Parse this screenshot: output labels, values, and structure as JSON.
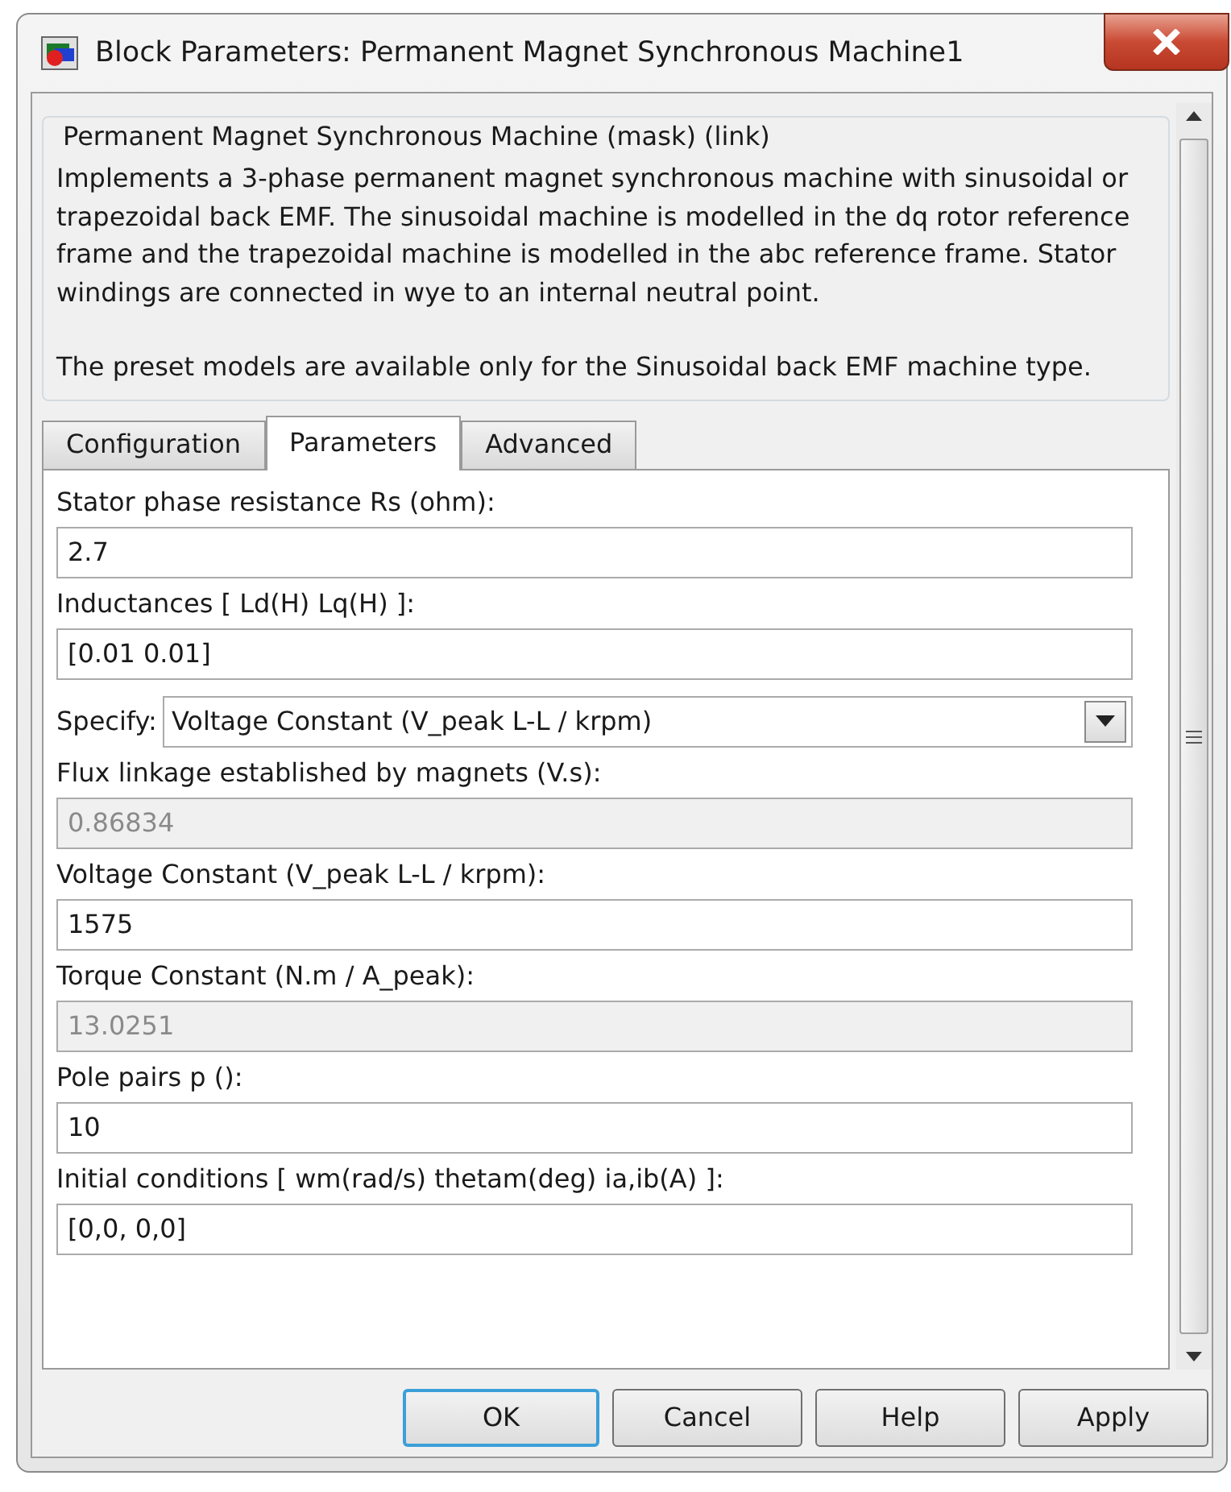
{
  "window": {
    "title": "Block Parameters: Permanent Magnet Synchronous Machine1"
  },
  "description": {
    "legend": "Permanent Magnet Synchronous Machine (mask) (link)",
    "paragraphs": [
      "Implements a 3-phase permanent magnet synchronous machine with sinusoidal or trapezoidal back EMF. The sinusoidal machine is modelled in the dq rotor reference frame and the trapezoidal machine is modelled in the abc reference frame. Stator windings are connected in wye to an internal neutral point.",
      "The preset models are available only for the Sinusoidal back EMF machine type."
    ]
  },
  "tabs": [
    {
      "label": "Configuration",
      "selected": false
    },
    {
      "label": "Parameters",
      "selected": true
    },
    {
      "label": "Advanced",
      "selected": false
    }
  ],
  "parameters": [
    {
      "kind": "text",
      "label": "Stator phase resistance Rs (ohm):",
      "value": "2.7",
      "disabled": false
    },
    {
      "kind": "text",
      "label": "Inductances [ Ld(H) Lq(H) ]:",
      "value": "[0.01 0.01]",
      "disabled": false
    },
    {
      "kind": "select",
      "label": "Specify:",
      "value": "Voltage Constant (V_peak L-L / krpm)",
      "disabled": false
    },
    {
      "kind": "text",
      "label": "Flux linkage established by magnets (V.s):",
      "value": "0.86834",
      "disabled": true
    },
    {
      "kind": "text",
      "label": "Voltage Constant (V_peak L-L / krpm):",
      "value": "1575",
      "disabled": false
    },
    {
      "kind": "text",
      "label": "Torque Constant (N.m / A_peak):",
      "value": "13.0251",
      "disabled": true
    },
    {
      "kind": "text",
      "label": "Pole pairs p ():",
      "value": "10",
      "disabled": false
    },
    {
      "kind": "text",
      "label": "Initial conditions  [ wm(rad/s)  thetam(deg)  ia,ib(A) ]:",
      "value": "[0,0, 0,0]",
      "disabled": false
    }
  ],
  "buttons": [
    {
      "label": "OK",
      "default": true
    },
    {
      "label": "Cancel",
      "default": false
    },
    {
      "label": "Help",
      "default": false
    },
    {
      "label": "Apply",
      "default": false
    }
  ]
}
